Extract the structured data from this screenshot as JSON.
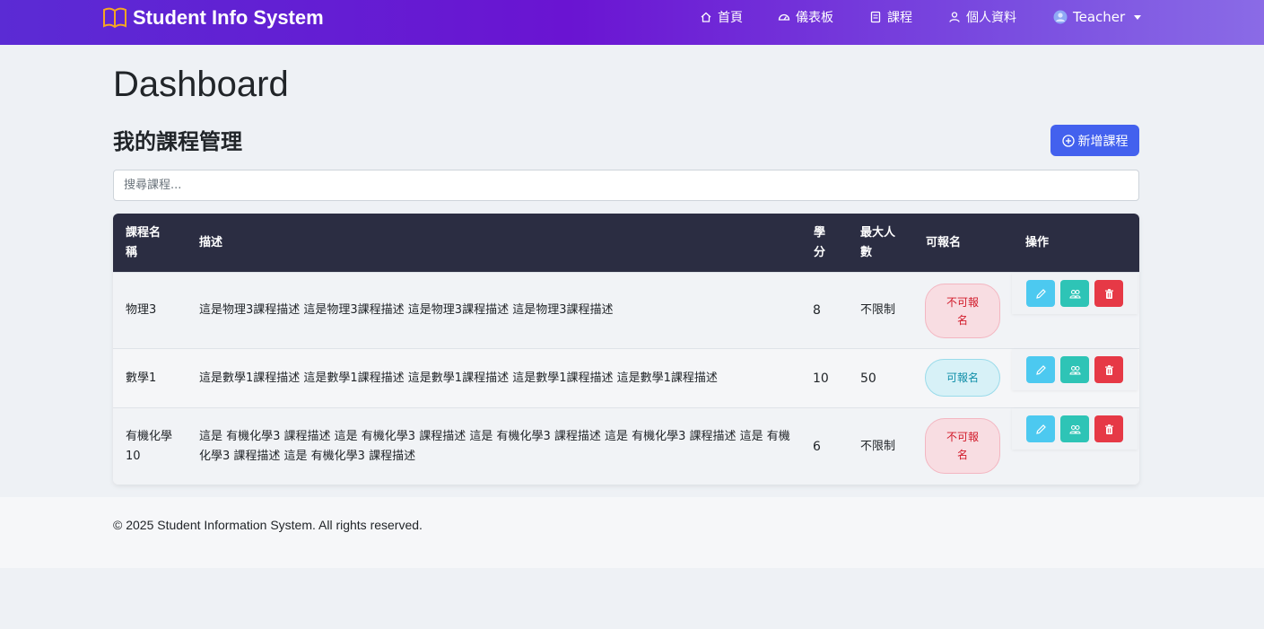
{
  "navbar": {
    "brand": "Student Info System",
    "items": [
      {
        "label": "首頁",
        "icon": "home-icon"
      },
      {
        "label": "儀表板",
        "icon": "gauge-icon"
      },
      {
        "label": "課程",
        "icon": "book-icon"
      },
      {
        "label": "個人資料",
        "icon": "person-icon"
      }
    ],
    "user": {
      "label": "Teacher",
      "icon": "user-circle-icon"
    }
  },
  "page": {
    "title": "Dashboard",
    "section_title": "我的課程管理",
    "add_button": "新增課程"
  },
  "search": {
    "placeholder": "搜尋課程...",
    "value": ""
  },
  "table": {
    "headers": {
      "name": "課程名稱",
      "description": "描述",
      "credits": "學分",
      "max": "最大人數",
      "enrollable": "可報名",
      "actions": "操作"
    },
    "rows": [
      {
        "name": "物理3",
        "description": "這是物理3課程描述 這是物理3課程描述 這是物理3課程描述 這是物理3課程描述",
        "credits": "8",
        "max": "不限制",
        "status": "不可報名",
        "status_type": "closed"
      },
      {
        "name": "數學1",
        "description": "這是數學1課程描述 這是數學1課程描述 這是數學1課程描述 這是數學1課程描述 這是數學1課程描述",
        "credits": "10",
        "max": "50",
        "status": "可報名",
        "status_type": "open"
      },
      {
        "name": "有機化學10",
        "description": "這是 有機化學3 課程描述 這是 有機化學3 課程描述 這是 有機化學3 課程描述 這是 有機化學3 課程描述 這是 有機化學3 課程描述 這是 有機化學3 課程描述",
        "credits": "6",
        "max": "不限制",
        "status": "不可報名",
        "status_type": "closed"
      }
    ]
  },
  "footer": {
    "text": "© 2025 Student Information System. All rights reserved."
  },
  "colors": {
    "accent": "#4361ee",
    "table_header": "#2b2d42",
    "edit": "#4cc9f0",
    "students": "#2ec4b6",
    "delete": "#e63946"
  }
}
